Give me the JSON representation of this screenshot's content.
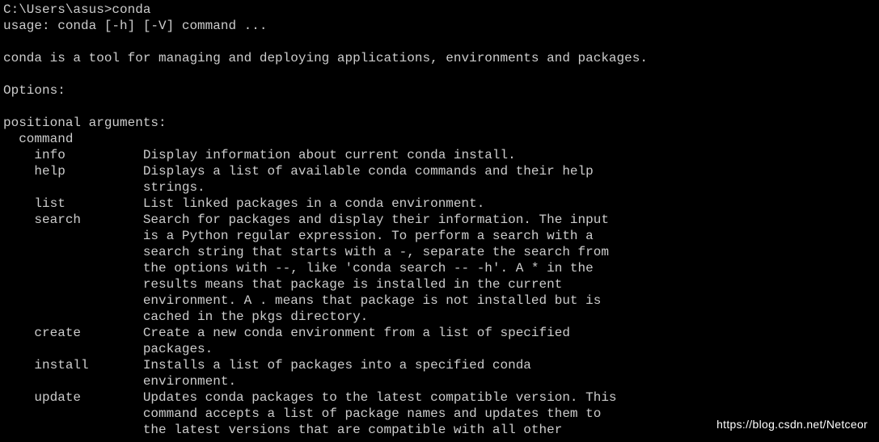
{
  "prompt": {
    "path": "C:\\Users\\asus>",
    "command": "conda"
  },
  "usage": "usage: conda [-h] [-V] command ...",
  "description": "conda is a tool for managing and deploying applications, environments and packages.",
  "options_header": "Options:",
  "positional_header": "positional arguments:",
  "command_label": "  command",
  "commands": {
    "info": {
      "name": "info",
      "desc": [
        "Display information about current conda install."
      ]
    },
    "help": {
      "name": "help",
      "desc": [
        "Displays a list of available conda commands and their help",
        "strings."
      ]
    },
    "list": {
      "name": "list",
      "desc": [
        "List linked packages in a conda environment."
      ]
    },
    "search": {
      "name": "search",
      "desc": [
        "Search for packages and display their information. The input",
        "is a Python regular expression. To perform a search with a",
        "search string that starts with a -, separate the search from",
        "the options with --, like 'conda search -- -h'. A * in the",
        "results means that package is installed in the current",
        "environment. A . means that package is not installed but is",
        "cached in the pkgs directory."
      ]
    },
    "create": {
      "name": "create",
      "desc": [
        "Create a new conda environment from a list of specified",
        "packages."
      ]
    },
    "install": {
      "name": "install",
      "desc": [
        "Installs a list of packages into a specified conda",
        "environment."
      ]
    },
    "update": {
      "name": "update",
      "desc": [
        "Updates conda packages to the latest compatible version. This",
        "command accepts a list of package names and updates them to",
        "the latest versions that are compatible with all other"
      ]
    }
  },
  "watermark": "https://blog.csdn.net/Netceor"
}
